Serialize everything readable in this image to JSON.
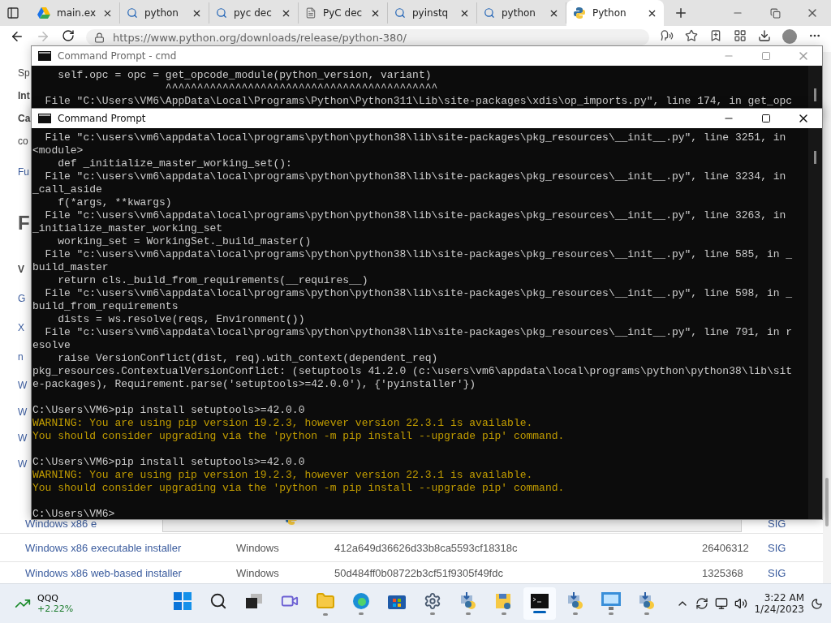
{
  "browser": {
    "tabs": [
      {
        "title": "main.ex",
        "kind": "drive",
        "selected": false
      },
      {
        "title": "python",
        "kind": "search",
        "selected": false
      },
      {
        "title": "pyc dec",
        "kind": "search",
        "selected": false
      },
      {
        "title": "PyC dec",
        "kind": "page",
        "selected": false
      },
      {
        "title": "pyinstq",
        "kind": "search",
        "selected": false
      },
      {
        "title": "python",
        "kind": "search",
        "selected": false
      },
      {
        "title": "Python",
        "kind": "python",
        "selected": true
      }
    ],
    "url": "https://www.python.org/downloads/release/python-380/",
    "page": {
      "fragments": [
        {
          "text": "Sp",
          "kind": "text"
        },
        {
          "text": "Int",
          "kind": "bold"
        },
        {
          "text": "Ca",
          "kind": "bold"
        },
        {
          "text": "co",
          "kind": "text"
        },
        {
          "text": "Fu",
          "kind": "link"
        },
        {
          "text": "F",
          "kind": "heading"
        },
        {
          "text": "V",
          "kind": "bold"
        },
        {
          "text": "G",
          "kind": "link"
        },
        {
          "text": "X",
          "kind": "link"
        },
        {
          "text": "n",
          "kind": "link"
        },
        {
          "text": "W",
          "kind": "link"
        },
        {
          "text": "W",
          "kind": "link"
        },
        {
          "text": "W",
          "kind": "link"
        },
        {
          "text": "W",
          "kind": "link"
        }
      ],
      "partial_row": {
        "name": "Windows x86 e",
        "sig": "SIG"
      },
      "rows": [
        {
          "name": "Windows x86 executable installer",
          "os": "Windows",
          "md5": "412a649d36626d33b8ca5593cf18318c",
          "size": "26406312",
          "sig": "SIG"
        },
        {
          "name": "Windows x86 web-based installer",
          "os": "Windows",
          "md5": "50d484ff0b08722b3cf51f9305f49fdc",
          "size": "1325368",
          "sig": "SIG"
        }
      ]
    }
  },
  "back_window": {
    "title": "Command Prompt - cmd",
    "lines": [
      {
        "kind": "normal",
        "text": "    self.opc = opc = get_opcode_module(python_version, variant)"
      },
      {
        "kind": "normal",
        "text": "                     ^^^^^^^^^^^^^^^^^^^^^^^^^^^^^^^^^^^^^^^^^^^"
      },
      {
        "kind": "normal",
        "text": "  File \"C:\\Users\\VM6\\AppData\\Local\\Programs\\Python\\Python311\\Lib\\site-packages\\xdis\\op_imports.py\", line 174, in get_opc"
      }
    ]
  },
  "front_window": {
    "title": "Command Prompt",
    "lines": [
      {
        "kind": "normal",
        "text": "  File \"c:\\users\\vm6\\appdata\\local\\programs\\python\\python38\\lib\\site-packages\\pkg_resources\\__init__.py\", line 3251, in"
      },
      {
        "kind": "normal",
        "text": "<module>"
      },
      {
        "kind": "normal",
        "text": "    def _initialize_master_working_set():"
      },
      {
        "kind": "normal",
        "text": "  File \"c:\\users\\vm6\\appdata\\local\\programs\\python\\python38\\lib\\site-packages\\pkg_resources\\__init__.py\", line 3234, in"
      },
      {
        "kind": "normal",
        "text": "_call_aside"
      },
      {
        "kind": "normal",
        "text": "    f(*args, **kwargs)"
      },
      {
        "kind": "normal",
        "text": "  File \"c:\\users\\vm6\\appdata\\local\\programs\\python\\python38\\lib\\site-packages\\pkg_resources\\__init__.py\", line 3263, in"
      },
      {
        "kind": "normal",
        "text": "_initialize_master_working_set"
      },
      {
        "kind": "normal",
        "text": "    working_set = WorkingSet._build_master()"
      },
      {
        "kind": "normal",
        "text": "  File \"c:\\users\\vm6\\appdata\\local\\programs\\python\\python38\\lib\\site-packages\\pkg_resources\\__init__.py\", line 585, in _"
      },
      {
        "kind": "normal",
        "text": "build_master"
      },
      {
        "kind": "normal",
        "text": "    return cls._build_from_requirements(__requires__)"
      },
      {
        "kind": "normal",
        "text": "  File \"c:\\users\\vm6\\appdata\\local\\programs\\python\\python38\\lib\\site-packages\\pkg_resources\\__init__.py\", line 598, in _"
      },
      {
        "kind": "normal",
        "text": "build_from_requirements"
      },
      {
        "kind": "normal",
        "text": "    dists = ws.resolve(reqs, Environment())"
      },
      {
        "kind": "normal",
        "text": "  File \"c:\\users\\vm6\\appdata\\local\\programs\\python\\python38\\lib\\site-packages\\pkg_resources\\__init__.py\", line 791, in r"
      },
      {
        "kind": "normal",
        "text": "esolve"
      },
      {
        "kind": "normal",
        "text": "    raise VersionConflict(dist, req).with_context(dependent_req)"
      },
      {
        "kind": "normal",
        "text": "pkg_resources.ContextualVersionConflict: (setuptools 41.2.0 (c:\\users\\vm6\\appdata\\local\\programs\\python\\python38\\lib\\sit"
      },
      {
        "kind": "normal",
        "text": "e-packages), Requirement.parse('setuptools>=42.0.0'), {'pyinstaller'})"
      },
      {
        "kind": "blank"
      },
      {
        "kind": "normal",
        "text": "C:\\Users\\VM6>pip install setuptools>=42.0.0"
      },
      {
        "kind": "warning",
        "text": "WARNING: You are using pip version 19.2.3, however version 22.3.1 is available."
      },
      {
        "kind": "warning",
        "text": "You should consider upgrading via the 'python -m pip install --upgrade pip' command."
      },
      {
        "kind": "blank"
      },
      {
        "kind": "normal",
        "text": "C:\\Users\\VM6>pip install setuptools>=42.0.0"
      },
      {
        "kind": "warning",
        "text": "WARNING: You are using pip version 19.2.3, however version 22.3.1 is available."
      },
      {
        "kind": "warning",
        "text": "You should consider upgrading via the 'python -m pip install --upgrade pip' command."
      },
      {
        "kind": "blank"
      },
      {
        "kind": "normal",
        "text": "C:\\Users\\VM6>"
      }
    ]
  },
  "taskbar": {
    "stock": {
      "symbol": "QQQ",
      "change": "+2.22%"
    },
    "apps": [
      {
        "kind": "start",
        "running": false,
        "selected": false
      },
      {
        "kind": "search",
        "running": false,
        "selected": false
      },
      {
        "kind": "taskview",
        "running": false,
        "selected": false
      },
      {
        "kind": "chat",
        "running": false,
        "selected": false
      },
      {
        "kind": "folder",
        "running": true,
        "selected": false
      },
      {
        "kind": "edge",
        "running": true,
        "selected": false
      },
      {
        "kind": "store",
        "running": false,
        "selected": false
      },
      {
        "kind": "settings",
        "running": true,
        "selected": false
      },
      {
        "kind": "installer",
        "running": true,
        "selected": false
      },
      {
        "kind": "disk",
        "running": true,
        "selected": false
      },
      {
        "kind": "terminal",
        "running": true,
        "selected": true
      },
      {
        "kind": "installer",
        "running": true,
        "selected": false
      },
      {
        "kind": "monitor",
        "running": true,
        "selected": false
      },
      {
        "kind": "installer",
        "running": true,
        "selected": false
      }
    ],
    "time": "3:22 AM",
    "date": "1/24/2023"
  }
}
